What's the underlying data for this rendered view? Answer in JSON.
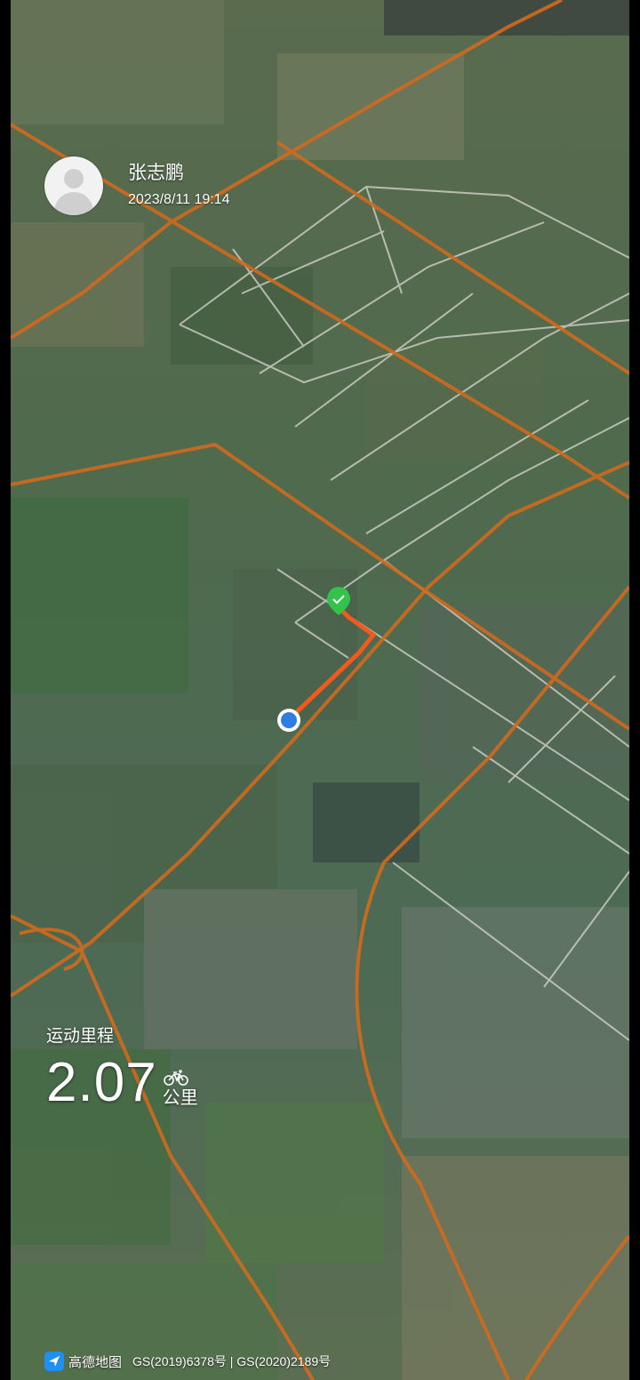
{
  "header": {
    "user_name": "张志鹏",
    "datetime": "2023/8/11 19:14",
    "avatar_icon": "default-avatar-icon"
  },
  "stats": {
    "label": "运动里程",
    "distance": "2.07",
    "unit": "公里",
    "activity_icon": "bicycle-icon"
  },
  "footer": {
    "map_brand": "高德地图",
    "license": "GS(2019)6378号 | GS(2020)2189号",
    "brand_icon": "amap-logo-icon"
  },
  "colors": {
    "road": "#d06a1e",
    "track": "#f05a1c",
    "start_marker": "#33c24a",
    "current_location": "#2f7de1"
  }
}
